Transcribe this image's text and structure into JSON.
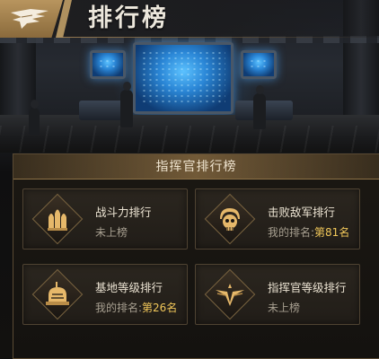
{
  "header": {
    "title": "排行榜"
  },
  "panel": {
    "title": "指挥官排行榜"
  },
  "rankings": [
    {
      "title": "战斗力排行",
      "status": "未上榜",
      "rank_prefix": "",
      "rank": "",
      "icon": "bullets-icon"
    },
    {
      "title": "击败敌军排行",
      "status": "",
      "rank_prefix": "我的排名:",
      "rank": "第81名",
      "icon": "skull-helmet-icon"
    },
    {
      "title": "基地等级排行",
      "status": "",
      "rank_prefix": "我的排名:",
      "rank": "第26名",
      "icon": "base-dome-icon"
    },
    {
      "title": "指挥官等级排行",
      "status": "未上榜",
      "rank_prefix": "",
      "rank": "",
      "icon": "commander-wings-icon"
    }
  ],
  "colors": {
    "accent_gold": "#c9a66b",
    "rank_highlight": "#f1c75a",
    "emblem_gold": "#e6b86a"
  }
}
